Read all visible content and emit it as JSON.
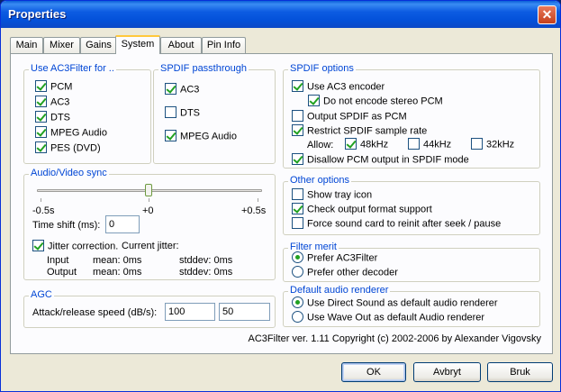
{
  "window": {
    "title": "Properties",
    "close": "✕"
  },
  "tabs": [
    "Main",
    "Mixer",
    "Gains",
    "System",
    "About",
    "Pin Info"
  ],
  "use_ac3filter": {
    "title": "Use AC3Filter for ..",
    "items": [
      {
        "label": "PCM",
        "checked": true
      },
      {
        "label": "AC3",
        "checked": true
      },
      {
        "label": "DTS",
        "checked": true
      },
      {
        "label": "MPEG Audio",
        "checked": true
      },
      {
        "label": "PES (DVD)",
        "checked": true
      }
    ]
  },
  "spdif_passthrough": {
    "title": "SPDIF passthrough",
    "items": [
      {
        "label": "AC3",
        "checked": true
      },
      {
        "label": "DTS",
        "checked": false
      },
      {
        "label": "MPEG Audio",
        "checked": true
      }
    ]
  },
  "spdif_options": {
    "title": "SPDIF options",
    "use_ac3_encoder": "Use AC3 encoder",
    "do_not_encode_stereo": "Do not encode stereo PCM",
    "output_spdif_as_pcm": "Output SPDIF as PCM",
    "restrict_sample_rate": "Restrict SPDIF sample rate",
    "allow_label": "Allow:",
    "rates": [
      {
        "label": "48kHz",
        "checked": true
      },
      {
        "label": "44kHz",
        "checked": false
      },
      {
        "label": "32kHz",
        "checked": false
      }
    ],
    "disallow_pcm": "Disallow PCM output in SPDIF mode"
  },
  "av_sync": {
    "title": "Audio/Video sync",
    "min_label": "-0.5s",
    "mid_label": "+0",
    "max_label": "+0.5s",
    "slider_value": 0,
    "time_shift_label": "Time shift (ms):",
    "time_shift_value": "0",
    "jitter_label": "Jitter correction.",
    "current_jitter": "Current jitter:",
    "input_label": "Input",
    "output_label": "Output",
    "input_mean": "mean: 0ms",
    "input_stddev": "stddev: 0ms",
    "output_mean": "mean: 0ms",
    "output_stddev": "stddev: 0ms"
  },
  "agc": {
    "title": "AGC",
    "label": "Attack/release speed (dB/s):",
    "attack": "100",
    "release": "50"
  },
  "other_options": {
    "title": "Other options",
    "show_tray_icon": "Show tray icon",
    "check_output_format": "Check output format support",
    "force_reinit": "Force sound card to reinit after seek / pause"
  },
  "filter_merit": {
    "title": "Filter merit",
    "prefer_ac3filter": "Prefer AC3Filter",
    "prefer_other": "Prefer other decoder"
  },
  "default_renderer": {
    "title": "Default audio renderer",
    "direct_sound": "Use Direct Sound as default audio renderer",
    "wave_out": "Use Wave Out as default Audio renderer"
  },
  "copyright": "AC3Filter ver. 1.11 Copyright (c) 2002-2006 by Alexander Vigovsky",
  "buttons": {
    "ok": "OK",
    "cancel": "Avbryt",
    "apply": "Bruk"
  }
}
